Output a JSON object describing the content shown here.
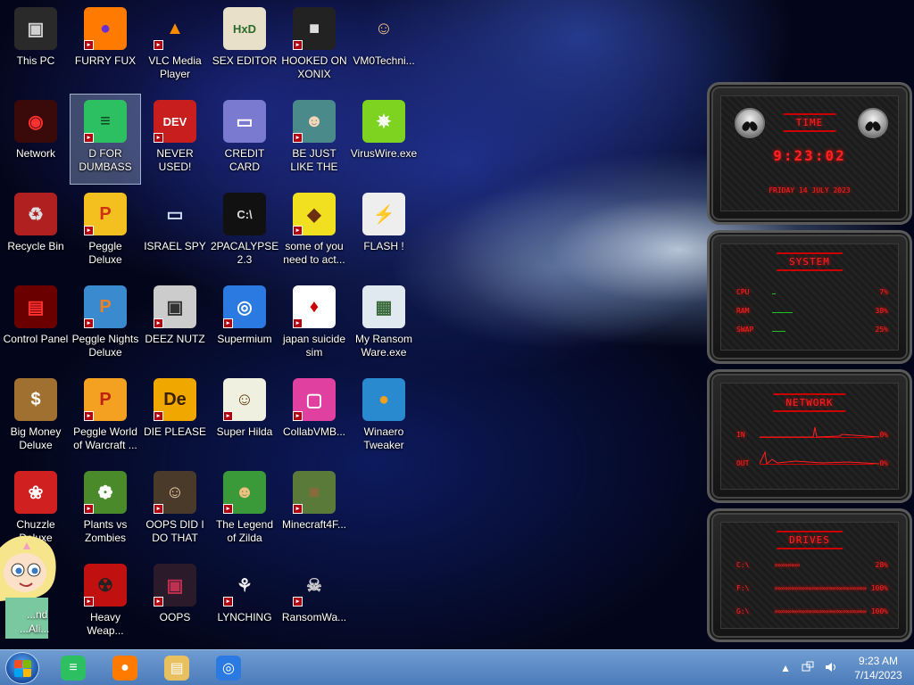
{
  "desktop": {
    "icons": [
      {
        "label": "This PC",
        "glyph": "▣",
        "bg": "#2a2a2a",
        "fg": "#d0d0d0",
        "badge": false
      },
      {
        "label": "FURRY FUX",
        "glyph": "●",
        "bg": "#ff7a00",
        "fg": "#6b2fd0",
        "badge": true
      },
      {
        "label": "VLC Media Player",
        "glyph": "▲",
        "bg": "transparent",
        "fg": "#ff8c00",
        "badge": true
      },
      {
        "label": "SEX EDITOR",
        "glyph": "HxD",
        "bg": "#e8e0c8",
        "fg": "#2c6a2c",
        "badge": false
      },
      {
        "label": "HOOKED ON XONIX",
        "glyph": "■",
        "bg": "#222",
        "fg": "#ddd",
        "badge": true
      },
      {
        "label": "VM0Techni...",
        "glyph": "☺",
        "bg": "transparent",
        "fg": "#f2c08a",
        "badge": false
      },
      {
        "label": "Network",
        "glyph": "◉",
        "bg": "#3a0a0a",
        "fg": "#ff3030",
        "badge": false
      },
      {
        "label": "D FOR DUMBASS",
        "glyph": "≡",
        "bg": "#2dc062",
        "fg": "#0d3a1e",
        "badge": true,
        "selected": true
      },
      {
        "label": "NEVER USED!",
        "glyph": "DEV",
        "bg": "#c81e1e",
        "fg": "#fff",
        "badge": true
      },
      {
        "label": "CREDIT CARD CHECKER",
        "glyph": "▭",
        "bg": "#7a7ad0",
        "fg": "#fff",
        "badge": false
      },
      {
        "label": "BE JUST LIKE THE DUDE!",
        "glyph": "☻",
        "bg": "#4a8a8a",
        "fg": "#f5d5b5",
        "badge": true
      },
      {
        "label": "VirusWire.exe",
        "glyph": "✵",
        "bg": "#7ed321",
        "fg": "#fff",
        "badge": false
      },
      {
        "label": "Recycle Bin",
        "glyph": "♻",
        "bg": "#b02020",
        "fg": "#ddd",
        "badge": false
      },
      {
        "label": "Peggle Deluxe",
        "glyph": "P",
        "bg": "#f4c020",
        "fg": "#d03010",
        "badge": true
      },
      {
        "label": "ISRAEL SPY",
        "glyph": "▭",
        "bg": "transparent",
        "fg": "#cfe0f5",
        "badge": false
      },
      {
        "label": "2PACALYPSE 2.3",
        "glyph": "C:\\",
        "bg": "#111",
        "fg": "#ddd",
        "badge": false
      },
      {
        "label": "some of you need to act...",
        "glyph": "◆",
        "bg": "#f0e020",
        "fg": "#6a3010",
        "badge": true
      },
      {
        "label": "FLASH !",
        "glyph": "⚡",
        "bg": "#eee",
        "fg": "#c00",
        "badge": false
      },
      {
        "label": "Control Panel",
        "glyph": "▤",
        "bg": "#6a0000",
        "fg": "#ff3030",
        "badge": false
      },
      {
        "label": "Peggle Nights Deluxe",
        "glyph": "P",
        "bg": "#3a8ad0",
        "fg": "#f08020",
        "badge": true
      },
      {
        "label": "DEEZ NUTZ",
        "glyph": "▣",
        "bg": "#ccc",
        "fg": "#333",
        "badge": true
      },
      {
        "label": "Supermium",
        "glyph": "◎",
        "bg": "#2a7ae2",
        "fg": "#fff",
        "badge": true
      },
      {
        "label": "japan suicide sim",
        "glyph": "♦",
        "bg": "#fff",
        "fg": "#c00",
        "badge": true
      },
      {
        "label": "My Ransom Ware.exe",
        "glyph": "▦",
        "bg": "#e0e8f0",
        "fg": "#3a6a3a",
        "badge": false
      },
      {
        "label": "Big Money Deluxe",
        "glyph": "$",
        "bg": "#a07030",
        "fg": "#fff",
        "badge": false
      },
      {
        "label": "Peggle World of Warcraft ...",
        "glyph": "P",
        "bg": "#f4a020",
        "fg": "#c02010",
        "badge": true
      },
      {
        "label": "DIE PLEASE",
        "glyph": "De",
        "bg": "#f0a800",
        "fg": "#3a2000",
        "badge": true
      },
      {
        "label": "Super Hilda",
        "glyph": "☺",
        "bg": "#f0f0e0",
        "fg": "#5a3a10",
        "badge": true
      },
      {
        "label": "CollabVMB...",
        "glyph": "▢",
        "bg": "#e040a0",
        "fg": "#fff",
        "badge": true
      },
      {
        "label": "Winaero Tweaker",
        "glyph": "●",
        "bg": "#2a8ad0",
        "fg": "#f0a020",
        "badge": false
      },
      {
        "label": "Chuzzle Deluxe",
        "glyph": "❀",
        "bg": "#d02020",
        "fg": "#fff",
        "badge": false
      },
      {
        "label": "Plants vs Zombies",
        "glyph": "❁",
        "bg": "#4a8a2a",
        "fg": "#fff",
        "badge": true
      },
      {
        "label": "OOPS DID I DO THAT",
        "glyph": "☺",
        "bg": "#4a3a2a",
        "fg": "#f0d0b0",
        "badge": true
      },
      {
        "label": "The Legend of Zilda",
        "glyph": "☻",
        "bg": "#3a9a3a",
        "fg": "#f0c080",
        "badge": true
      },
      {
        "label": "Minecraft4F...",
        "glyph": "■",
        "bg": "#5a7a3a",
        "fg": "#8a6a3a",
        "badge": true
      },
      {
        "label": "Heavy Weap...",
        "glyph": "☢",
        "bg": "#c01010",
        "fg": "#222",
        "badge": true
      },
      {
        "label": "OOPS",
        "glyph": "▣",
        "bg": "#2a1a2a",
        "fg": "#c03050",
        "badge": true
      },
      {
        "label": "LYNCHING",
        "glyph": "⚘",
        "bg": "transparent",
        "fg": "#eee",
        "badge": true
      },
      {
        "label": "RansomWa...",
        "glyph": "☠",
        "bg": "transparent",
        "fg": "#ccc",
        "badge": true
      }
    ],
    "partial_labels": {
      "top": "...nd",
      "bottom": "...Ali..."
    }
  },
  "gadget": {
    "time_title": "TIME",
    "clock": "9:23:02",
    "date": "FRIDAY 14 JULY 2023",
    "system_title": "SYSTEM",
    "cpu_label": "CPU",
    "cpu_value": "7%",
    "cpu_level": 0.07,
    "ram_label": "RAM",
    "ram_value": "38%",
    "ram_level": 0.38,
    "swap_label": "SWAP",
    "swap_value": "25%",
    "swap_level": 0.25,
    "network_title": "NETWORK",
    "in_label": "IN",
    "in_value": "0%",
    "out_label": "OUT",
    "out_value": "0%",
    "drives_title": "DRIVES",
    "drives": [
      {
        "label": "C:\\",
        "value": "28%",
        "level": 0.28
      },
      {
        "label": "F:\\",
        "value": "100%",
        "level": 1.0
      },
      {
        "label": "G:\\",
        "value": "100%",
        "level": 1.0
      }
    ]
  },
  "taskbar": {
    "apps": [
      {
        "name": "taskbar-spotify-app",
        "glyph": "≡",
        "bg": "#2dc062"
      },
      {
        "name": "taskbar-firefox-app",
        "glyph": "●",
        "bg": "#ff7a00"
      },
      {
        "name": "taskbar-explorer-app",
        "glyph": "▤",
        "bg": "#e8c060"
      },
      {
        "name": "taskbar-supermium-app",
        "glyph": "◎",
        "bg": "#2a7ae2"
      }
    ],
    "tray_arrow": "▲",
    "time": "9:23 AM",
    "date": "7/14/2023"
  },
  "colors": {
    "gadget_red": "#ff2020",
    "taskbar": "#5a8ac6"
  }
}
